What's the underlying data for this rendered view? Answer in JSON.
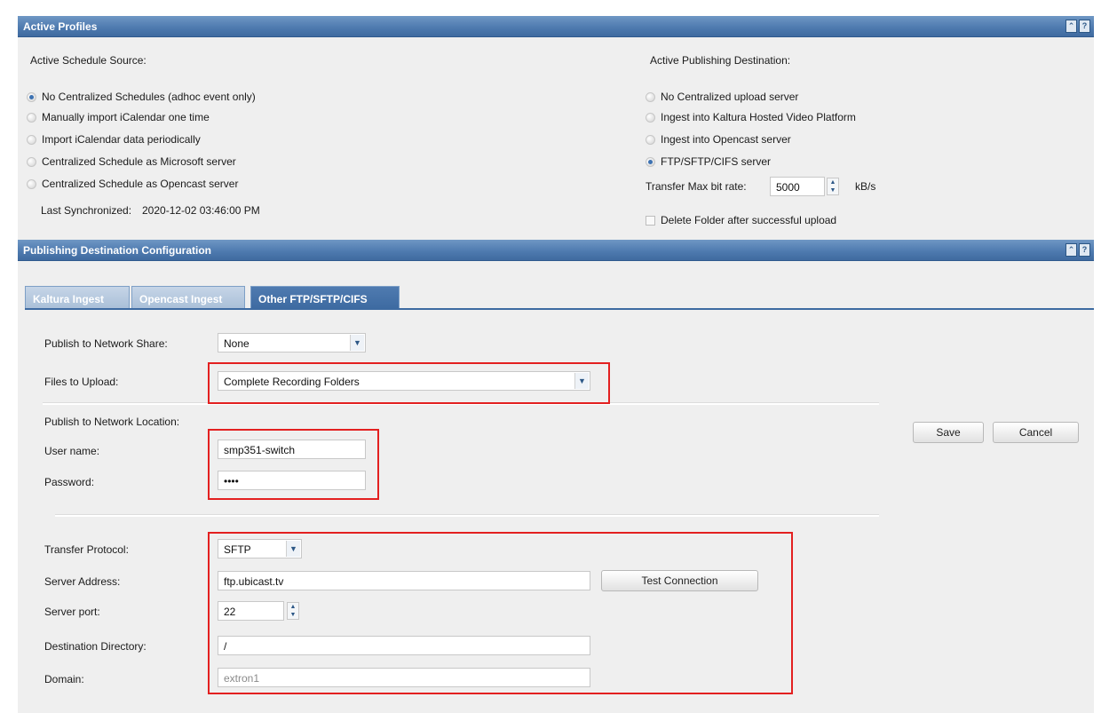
{
  "active_profiles": {
    "title": "Active Profiles",
    "schedule_source": {
      "label": "Active Schedule Source:",
      "options": [
        {
          "label": "No Centralized Schedules (adhoc event only)",
          "selected": true
        },
        {
          "label": "Manually import iCalendar one time",
          "selected": false
        },
        {
          "label": "Import iCalendar data periodically",
          "selected": false
        },
        {
          "label": "Centralized Schedule as Microsoft server",
          "selected": false
        },
        {
          "label": "Centralized Schedule as Opencast server",
          "selected": false
        }
      ],
      "last_sync_label": "Last Synchronized:",
      "last_sync_value": "2020-12-02 03:46:00 PM"
    },
    "publishing_destination": {
      "label": "Active Publishing Destination:",
      "options": [
        {
          "label": "No Centralized upload server",
          "selected": false
        },
        {
          "label": "Ingest into Kaltura Hosted Video Platform",
          "selected": false
        },
        {
          "label": "Ingest into Opencast server",
          "selected": false
        },
        {
          "label": "FTP/SFTP/CIFS server",
          "selected": true
        }
      ],
      "bitrate_label": "Transfer Max bit rate:",
      "bitrate_value": "5000",
      "bitrate_unit": "kB/s",
      "delete_folder_label": "Delete Folder after successful upload",
      "delete_folder_checked": false
    }
  },
  "config": {
    "title": "Publishing Destination Configuration",
    "tabs": [
      {
        "label": "Kaltura Ingest",
        "active": false
      },
      {
        "label": "Opencast Ingest",
        "active": false
      },
      {
        "label": "Other FTP/SFTP/CIFS",
        "active": true
      }
    ],
    "network_share": {
      "label": "Publish to Network Share:",
      "value": "None"
    },
    "files_to_upload": {
      "label": "Files to Upload:",
      "value": "Complete Recording Folders"
    },
    "network_location_label": "Publish to Network Location:",
    "username": {
      "label": "User name:",
      "value": "smp351-switch"
    },
    "password": {
      "label": "Password:",
      "value": "••••"
    },
    "transfer_protocol": {
      "label": "Transfer Protocol:",
      "value": "SFTP"
    },
    "server_address": {
      "label": "Server Address:",
      "value": "ftp.ubicast.tv"
    },
    "test_connection": "Test Connection",
    "server_port": {
      "label": "Server port:",
      "value": "22"
    },
    "destination_directory": {
      "label": "Destination Directory:",
      "value": "/"
    },
    "domain": {
      "label": "Domain:",
      "value": "extron1"
    },
    "save": "Save",
    "cancel": "Cancel"
  },
  "icons": {
    "collapse": "collapse-icon",
    "help": "help-icon",
    "dropdown": "chevron-down-icon",
    "spinner": "spinner-arrows-icon"
  },
  "colors": {
    "header_blue": "#4f7bb0",
    "panel_bg": "#efefef",
    "highlight_red": "#e32020",
    "radio_selected": "#3d72b2"
  }
}
